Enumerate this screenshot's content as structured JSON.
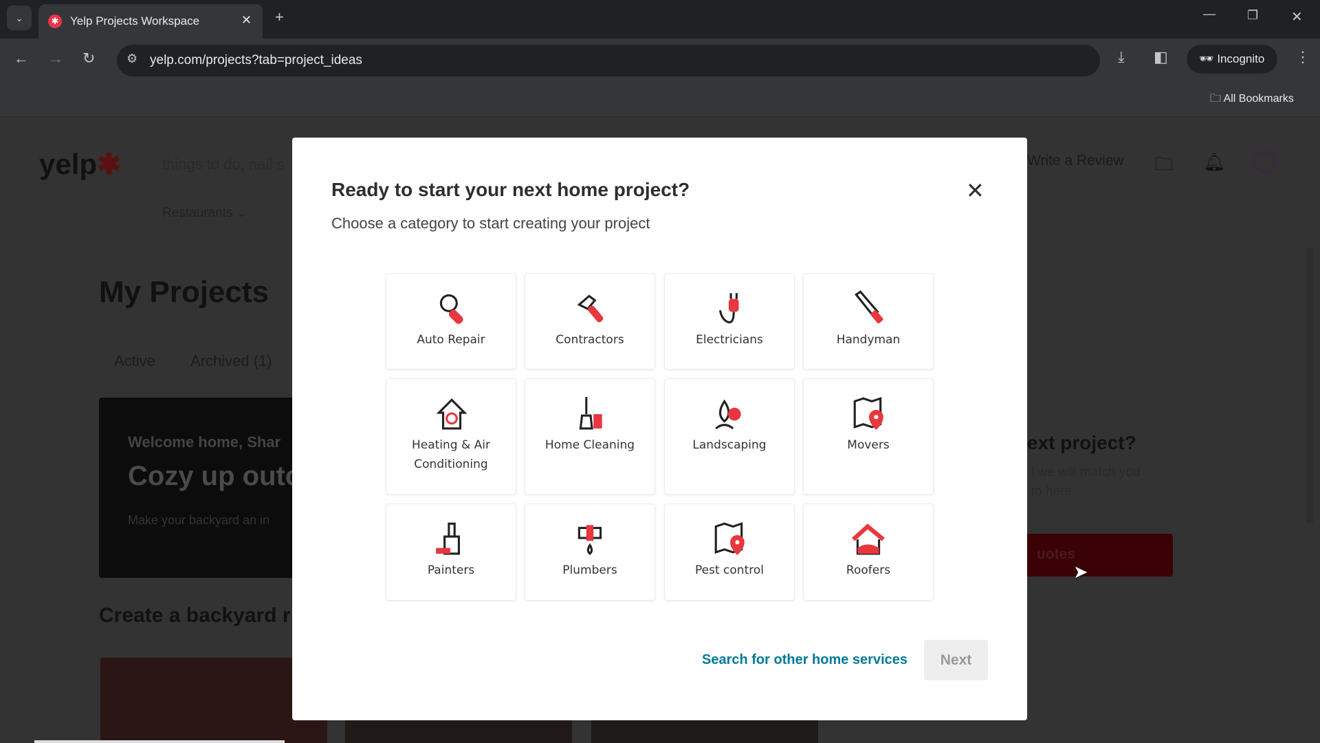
{
  "browser": {
    "tab_title": "Yelp Projects Workspace",
    "url": "yelp.com/projects?tab=project_ideas",
    "incognito_label": "Incognito",
    "bookmarks_label": "All Bookmarks"
  },
  "header": {
    "logo": "yelp",
    "search_placeholder": "things to do, nail s",
    "nav_restaurants": "Restaurants",
    "write_review": "Write a Review"
  },
  "main": {
    "title": "My Projects",
    "tabs": [
      {
        "label": "Active"
      },
      {
        "label": "Archived (1)"
      }
    ],
    "banner": {
      "greeting": "Welcome home, Shar",
      "headline": "Cozy up outc",
      "body": "Make your backyard an in"
    },
    "section_title": "Create a backyard r",
    "side_card": {
      "title": "ext project?",
      "body_line1": "l we will match you",
      "body_line2": "to here.",
      "button": "uotes"
    }
  },
  "modal": {
    "title": "Ready to start your next home project?",
    "subtitle": "Choose a category to start creating your project",
    "categories": [
      {
        "label": "Auto Repair",
        "icon": "wrench-icon"
      },
      {
        "label": "Contractors",
        "icon": "hammer-icon"
      },
      {
        "label": "Electricians",
        "icon": "plug-icon"
      },
      {
        "label": "Handyman",
        "icon": "saw-icon"
      },
      {
        "label": "Heating & Air",
        "label2": "Conditioning",
        "icon": "house-hvac-icon"
      },
      {
        "label": "Home Cleaning",
        "icon": "broom-icon"
      },
      {
        "label": "Landscaping",
        "icon": "tree-icon"
      },
      {
        "label": "Movers",
        "icon": "map-pin-icon"
      },
      {
        "label": "Painters",
        "icon": "paintbrush-icon"
      },
      {
        "label": "Plumbers",
        "icon": "faucet-icon"
      },
      {
        "label": "Pest control",
        "icon": "map-pin-icon"
      },
      {
        "label": "Roofers",
        "icon": "roof-icon"
      }
    ],
    "search_link": "Search for other home services",
    "next_button": "Next"
  },
  "colors": {
    "brand_red": "#e8373e",
    "link_teal": "#027a97"
  }
}
